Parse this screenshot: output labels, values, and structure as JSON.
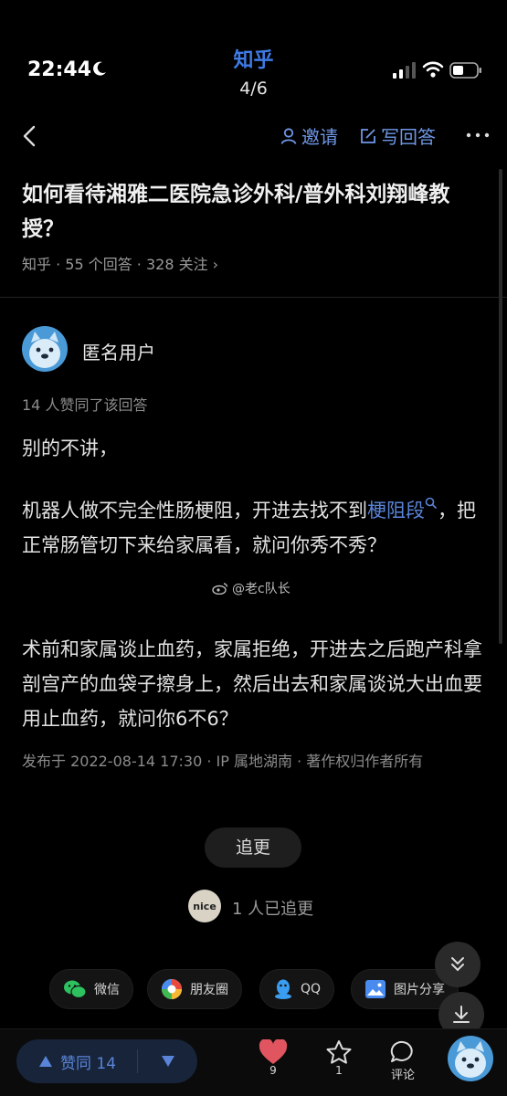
{
  "status_bar": {
    "time": "22:44"
  },
  "app": {
    "name": "知乎",
    "page_indicator": "4/6"
  },
  "nav": {
    "invite_label": "邀请",
    "write_answer_label": "写回答"
  },
  "question": {
    "title": "如何看待湘雅二医院急诊外科/普外科刘翔峰教授？",
    "meta": "知乎 · 55 个回答 · 328 关注 ›"
  },
  "answer": {
    "author": "匿名用户",
    "votes_line": "14 人赞同了该回答",
    "paragraphs": {
      "p1": "别的不讲，",
      "p2_before": "机器人做不完全性肠梗阻，开进去找不到",
      "p2_link": "梗阻段",
      "p2_after": "，把正常肠管切下来给家属看，就问你秀不秀？",
      "p3": "术前和家属谈止血药，家属拒绝，开进去之后跑产科拿剖宫产的血袋子擦身上，然后出去和家属谈说大出血要用止血药，就问你6不6？"
    },
    "publish_info": "发布于 2022-08-14 17:30 · IP 属地湖南 · 著作权归作者所有"
  },
  "watermark": "@老c队长",
  "follow": {
    "button_label": "追更",
    "follower_avatar_text": "nice",
    "count_label": "1 人已追更"
  },
  "share": {
    "wechat": "微信",
    "moments": "朋友圈",
    "qq": "QQ",
    "image_share": "图片分享"
  },
  "bottom_bar": {
    "upvote_label": "赞同 14",
    "like_count": "9",
    "favorite_count": "1",
    "comment_label": "评论"
  },
  "colors": {
    "accent": "#5a84d8",
    "brand": "#3e7be6",
    "like": "#e0555f",
    "background": "#000000"
  },
  "icons": [
    "moon-icon",
    "signal-icon",
    "wifi-icon",
    "battery-icon",
    "back-icon",
    "person-icon",
    "edit-icon",
    "more-icon",
    "search-icon",
    "wechat-icon",
    "moments-icon",
    "qq-icon",
    "image-icon",
    "double-chevron-down-icon",
    "download-icon",
    "upvote-icon",
    "downvote-icon",
    "heart-icon",
    "star-icon",
    "comment-icon"
  ]
}
